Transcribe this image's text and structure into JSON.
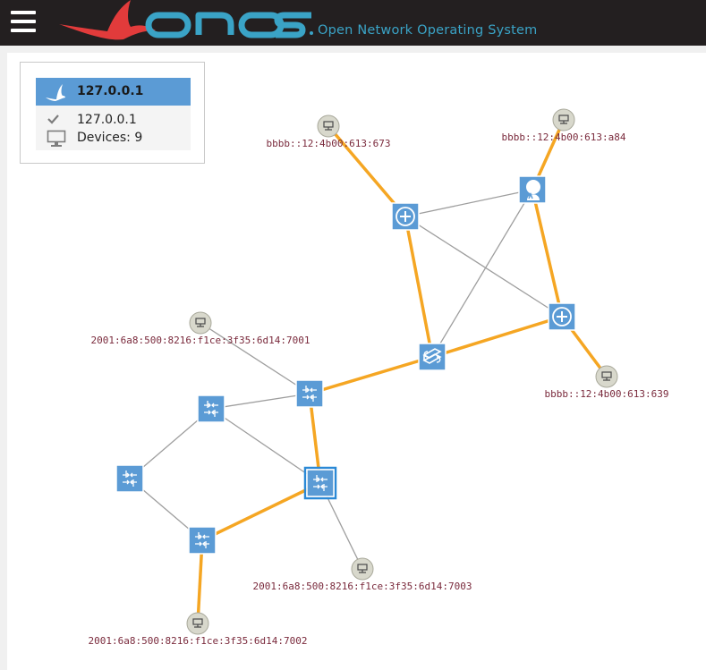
{
  "header": {
    "logo_text": "onos",
    "tagline": "Open Network Operating System",
    "colors": {
      "bar": "#231f20",
      "logo": "#3aa3c6",
      "bird": "#e23b3b"
    }
  },
  "summary_panel": {
    "title": "127.0.0.1",
    "address": "127.0.0.1",
    "devices": "Devices: 9",
    "colors": {
      "header": "#5b9bd5"
    }
  },
  "topology": {
    "colors": {
      "switch": "#5b9bd5",
      "host": "#d8d8cc",
      "optical_link": "#f5a623",
      "plain_link": "#9e9e9e",
      "label": "#7a2a3c"
    },
    "hosts": [
      {
        "id": "h1",
        "label": "bbbb::12:4b00:613:673"
      },
      {
        "id": "h2",
        "label": "bbbb::12:4b00:613:a84"
      },
      {
        "id": "h3",
        "label": "2001:6a8:500:8216:f1ce:3f35:6d14:7001"
      },
      {
        "id": "h4",
        "label": "bbbb::12:4b00:613:639"
      },
      {
        "id": "h5",
        "label": "2001:6a8:500:8216:f1ce:3f35:6d14:7003"
      },
      {
        "id": "h6",
        "label": "2001:6a8:500:8216:f1ce:3f35:6d14:7002"
      }
    ],
    "devices": [
      {
        "id": "d1",
        "icon": "router-icon"
      },
      {
        "id": "d2",
        "icon": "user-node-icon"
      },
      {
        "id": "d3",
        "icon": "router-icon"
      },
      {
        "id": "d4",
        "icon": "coupler-icon"
      },
      {
        "id": "d5",
        "icon": "switch-icon"
      },
      {
        "id": "d6",
        "icon": "switch-icon"
      },
      {
        "id": "d7",
        "icon": "switch-icon"
      },
      {
        "id": "d8",
        "icon": "switch-icon",
        "selected": true
      },
      {
        "id": "d9",
        "icon": "switch-icon"
      }
    ],
    "links": [
      {
        "a": "h1",
        "b": "d1",
        "kind": "optical"
      },
      {
        "a": "h2",
        "b": "d2",
        "kind": "optical"
      },
      {
        "a": "d1",
        "b": "d2",
        "kind": "plain"
      },
      {
        "a": "d1",
        "b": "d3",
        "kind": "plain"
      },
      {
        "a": "d2",
        "b": "d3",
        "kind": "optical"
      },
      {
        "a": "d1",
        "b": "d4",
        "kind": "optical"
      },
      {
        "a": "d2",
        "b": "d4",
        "kind": "plain"
      },
      {
        "a": "d3",
        "b": "d4",
        "kind": "optical"
      },
      {
        "a": "d3",
        "b": "h4",
        "kind": "optical"
      },
      {
        "a": "d4",
        "b": "d5",
        "kind": "optical"
      },
      {
        "a": "h3",
        "b": "d5",
        "kind": "plain"
      },
      {
        "a": "d5",
        "b": "d6",
        "kind": "plain"
      },
      {
        "a": "d5",
        "b": "d8",
        "kind": "optical"
      },
      {
        "a": "d6",
        "b": "d8",
        "kind": "plain"
      },
      {
        "a": "d6",
        "b": "d7",
        "kind": "plain"
      },
      {
        "a": "d7",
        "b": "d9",
        "kind": "plain"
      },
      {
        "a": "d8",
        "b": "d9",
        "kind": "optical"
      },
      {
        "a": "d8",
        "b": "h5",
        "kind": "plain"
      },
      {
        "a": "d9",
        "b": "h6",
        "kind": "optical"
      }
    ]
  }
}
